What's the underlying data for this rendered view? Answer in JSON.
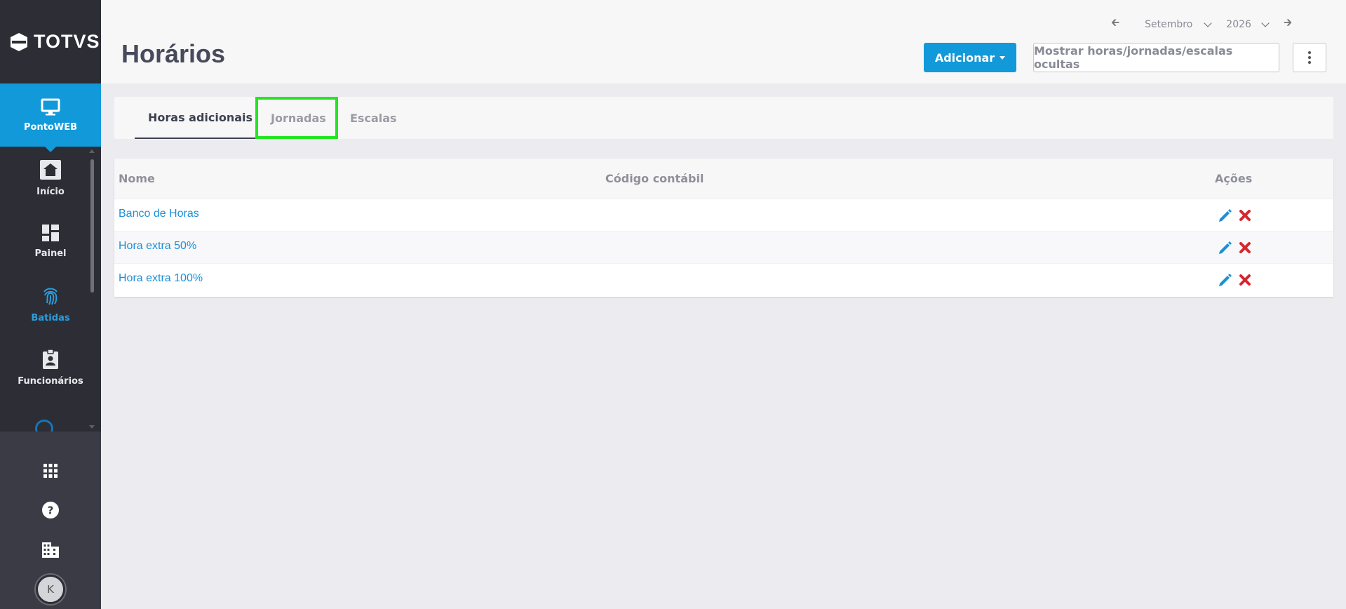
{
  "brand": {
    "logo_text": "TOTVS"
  },
  "sidebar": {
    "module": {
      "label": "PontoWEB",
      "icon": "monitor-icon"
    },
    "items": [
      {
        "label": "Início",
        "icon": "home-icon"
      },
      {
        "label": "Painel",
        "icon": "dashboard-icon"
      },
      {
        "label": "Batidas",
        "icon": "fingerprint-icon",
        "active": true
      },
      {
        "label": "Funcionários",
        "icon": "badge-icon"
      }
    ],
    "bottom": [
      {
        "icon": "apps-grid-icon"
      },
      {
        "icon": "help-icon"
      },
      {
        "icon": "company-icon"
      }
    ],
    "avatar_initial": "K"
  },
  "header": {
    "title": "Horários",
    "date": {
      "month": "Setembro",
      "year": "2026"
    },
    "add_button": "Adicionar",
    "show_hidden_button": "Mostrar horas/jornadas/escalas ocultas"
  },
  "tabs": [
    {
      "label": "Horas adicionais",
      "active": true
    },
    {
      "label": "Jornadas",
      "highlighted": true
    },
    {
      "label": "Escalas"
    }
  ],
  "table": {
    "columns": [
      "Nome",
      "Código contábil",
      "Ações"
    ],
    "rows": [
      {
        "name": "Banco de Horas",
        "code": ""
      },
      {
        "name": "Hora extra 50%",
        "code": ""
      },
      {
        "name": "Hora extra 100%",
        "code": ""
      }
    ]
  },
  "colors": {
    "accent": "#1199d9",
    "sidebar": "#2c2d35",
    "delete": "#d6262e",
    "highlight": "#22e622"
  }
}
